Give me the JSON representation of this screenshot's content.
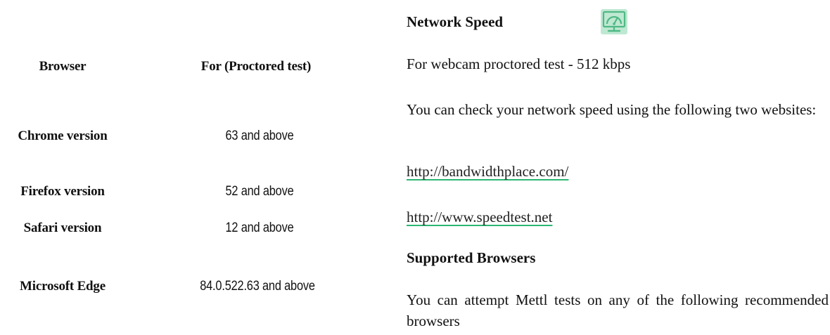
{
  "browser_table": {
    "headers": {
      "browser": "Browser",
      "version": "For (Proctored test)"
    },
    "rows": [
      {
        "browser": "Chrome version",
        "version": "63 and above"
      },
      {
        "browser": "Firefox version",
        "version": "52 and above"
      },
      {
        "browser": "Safari version",
        "version": "12 and above"
      },
      {
        "browser": "Microsoft Edge",
        "version": "84.0.522.63 and above"
      }
    ]
  },
  "network": {
    "heading": "Network Speed",
    "icon": "speedometer-monitor-icon",
    "requirement": "For webcam proctored test - 512 kbps",
    "check_text": "You can check your network speed using the following two websites:",
    "links": [
      "http://bandwidthplace.com/",
      "http://www.speedtest.net"
    ]
  },
  "browsers_section": {
    "heading": "Supported Browsers",
    "text": "You can attempt Mettl tests on any of the following recommended browsers"
  },
  "colors": {
    "link_underline": "#2bb673",
    "icon_green": "#6cc79a"
  }
}
